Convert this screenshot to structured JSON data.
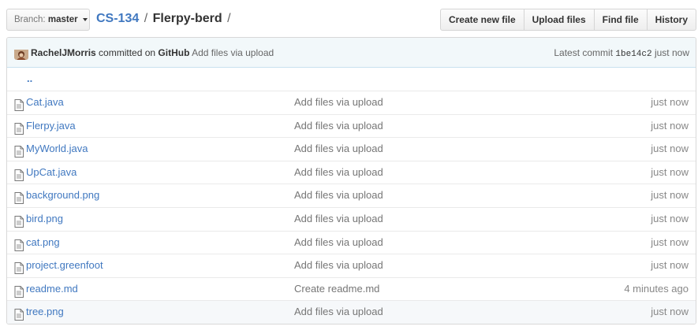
{
  "branch": {
    "label": "Branch:",
    "name": "master"
  },
  "breadcrumb": {
    "repo": "CS-134",
    "separator": "/",
    "dir": "Flerpy-berd",
    "trailing": "/"
  },
  "actions": {
    "create": "Create new file",
    "upload": "Upload files",
    "find": "Find file",
    "history": "History"
  },
  "commit": {
    "author": "RachelJMorris",
    "committed_on": "committed on",
    "platform": "GitHub",
    "message": "Add files via upload",
    "latest_label": "Latest commit",
    "sha": "1be14c2",
    "time": "just now"
  },
  "parent_link": "..",
  "files": [
    {
      "name": "Cat.java",
      "message": "Add files via upload",
      "age": "just now"
    },
    {
      "name": "Flerpy.java",
      "message": "Add files via upload",
      "age": "just now"
    },
    {
      "name": "MyWorld.java",
      "message": "Add files via upload",
      "age": "just now"
    },
    {
      "name": "UpCat.java",
      "message": "Add files via upload",
      "age": "just now"
    },
    {
      "name": "background.png",
      "message": "Add files via upload",
      "age": "just now"
    },
    {
      "name": "bird.png",
      "message": "Add files via upload",
      "age": "just now"
    },
    {
      "name": "cat.png",
      "message": "Add files via upload",
      "age": "just now"
    },
    {
      "name": "project.greenfoot",
      "message": "Add files via upload",
      "age": "just now"
    },
    {
      "name": "readme.md",
      "message": "Create readme.md",
      "age": "4 minutes ago"
    },
    {
      "name": "tree.png",
      "message": "Add files via upload",
      "age": "just now"
    }
  ]
}
